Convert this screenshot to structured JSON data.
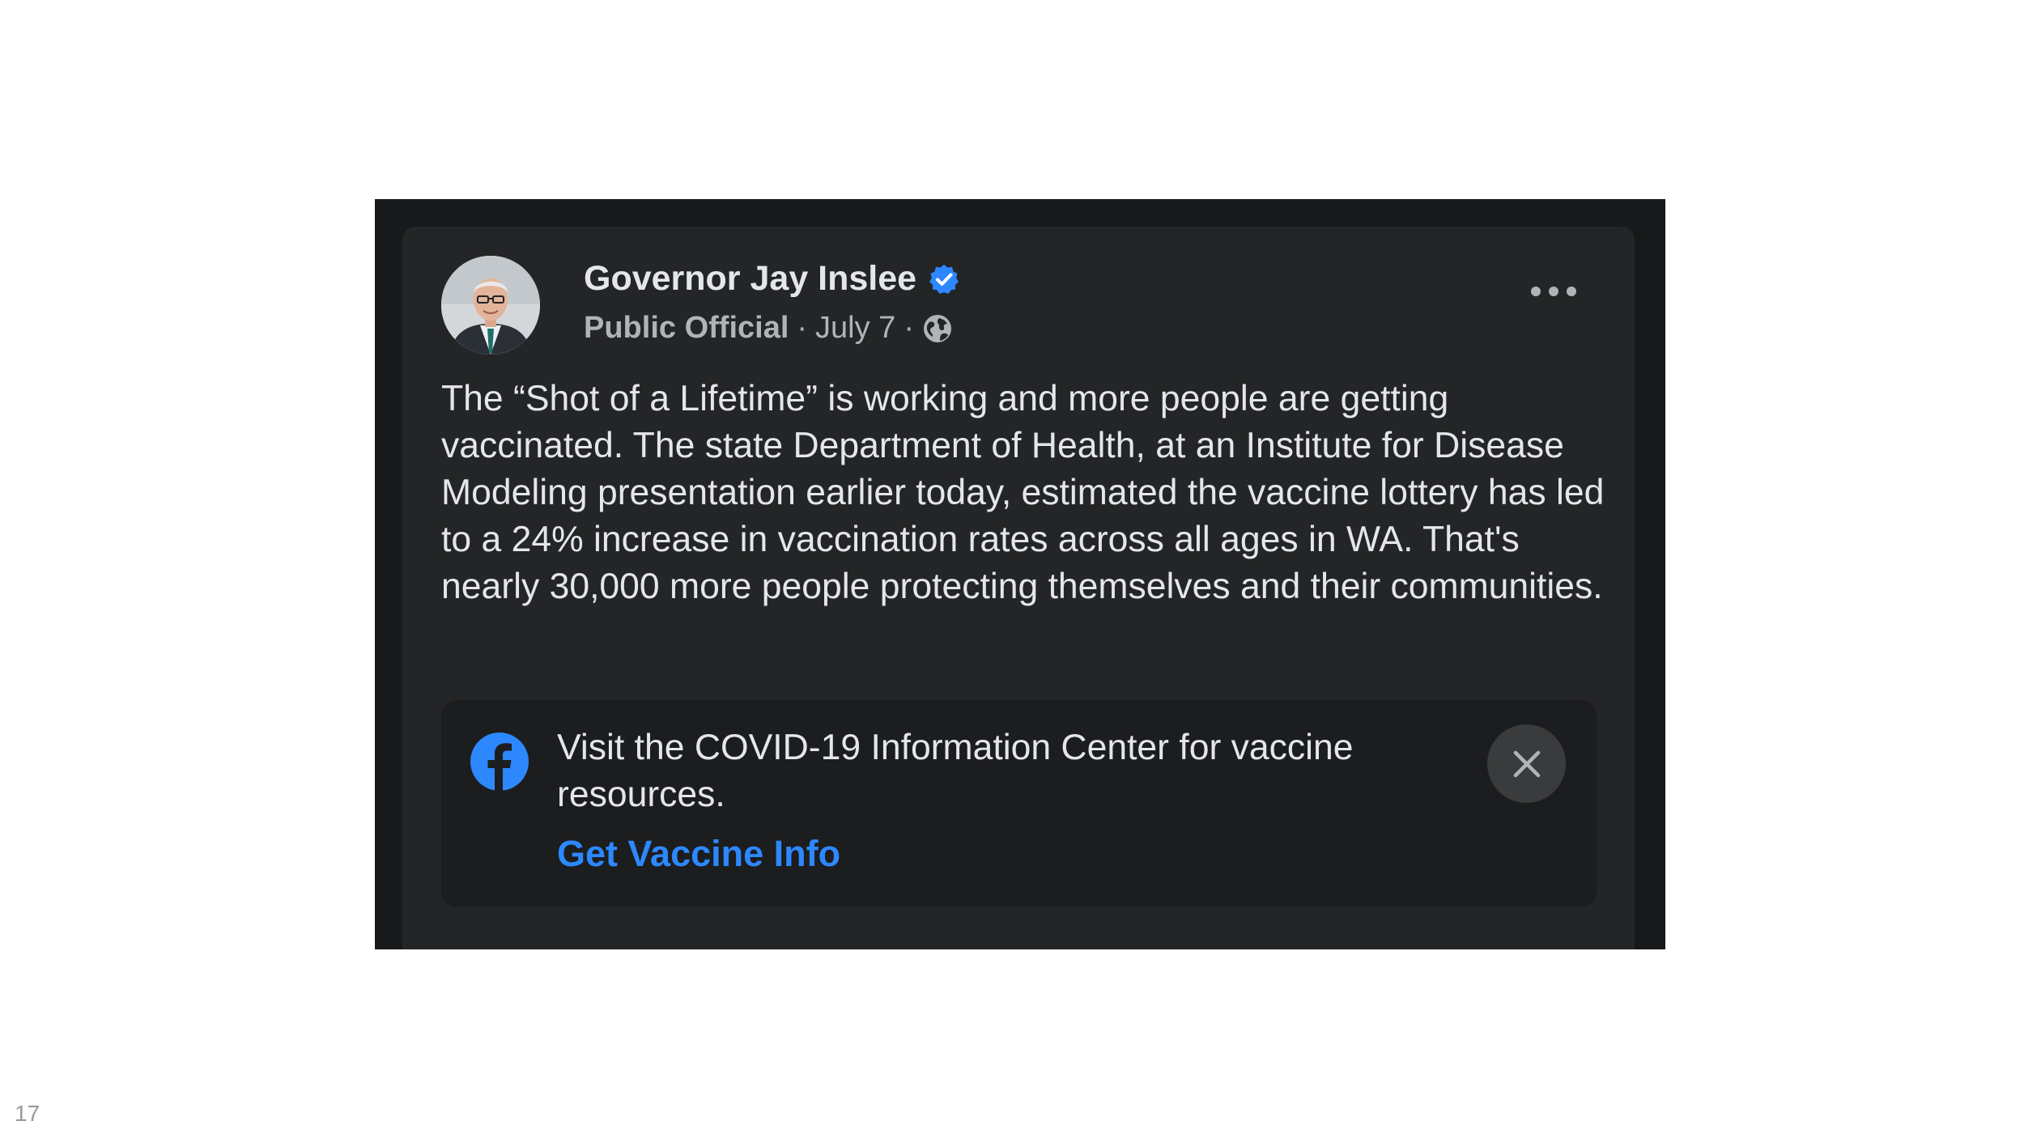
{
  "post": {
    "author": "Governor Jay Inslee",
    "role": "Public Official",
    "date": "July 7",
    "separator": "·",
    "text": "The “Shot of a Lifetime” is working and more people are getting vaccinated. The state Department of Health, at an Institute for Disease Modeling presentation earlier today, estimated the vaccine lottery has led to a 24% increase in vaccination rates across all ages in WA. That's nearly 30,000 more people protecting themselves and their communities."
  },
  "info_box": {
    "message": "Visit the COVID-19 Information Center for vaccine resources.",
    "link": "Get Vaccine Info"
  },
  "slide_number": "17",
  "icons": {
    "avatar": "profile-photo",
    "verified": "verified-badge-icon",
    "privacy": "globe-icon",
    "menu": "more-options-icon",
    "brand": "facebook-logo-icon",
    "close": "close-icon"
  },
  "colors": {
    "frame_bg": "#18191a",
    "card_bg": "#242526",
    "text_primary": "#e4e6eb",
    "text_secondary": "#b0b3b8",
    "link": "#2d88ff",
    "verified": "#2d88ff"
  }
}
